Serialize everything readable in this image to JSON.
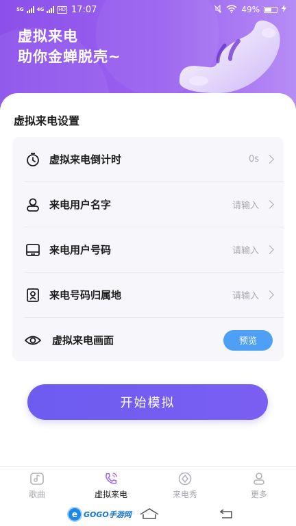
{
  "status_bar": {
    "net1": "5G",
    "net2": "4G",
    "hd": "HD",
    "time": "17:07",
    "battery": "49%"
  },
  "hero": {
    "line1": "虚拟来电",
    "line2": "助你金蝉脱壳~"
  },
  "settings": {
    "title": "虚拟来电设置",
    "rows": [
      {
        "label": "虚拟来电倒计时",
        "value": "0s",
        "icon": "timer-icon"
      },
      {
        "label": "来电用户名字",
        "value": "请输入",
        "icon": "user-icon"
      },
      {
        "label": "来电用户号码",
        "value": "请输入",
        "icon": "phone-number-icon"
      },
      {
        "label": "来电号码归属地",
        "value": "请输入",
        "icon": "location-icon"
      },
      {
        "label": "虚拟来电画面",
        "button": "预览",
        "icon": "eye-icon"
      }
    ]
  },
  "start_button": "开始模拟",
  "tabs": [
    {
      "label": "歌曲",
      "icon": "music-icon",
      "active": false
    },
    {
      "label": "虚拟来电",
      "icon": "call-icon",
      "active": true
    },
    {
      "label": "来电秀",
      "icon": "show-icon",
      "active": false
    },
    {
      "label": "更多",
      "icon": "more-icon",
      "active": false
    }
  ],
  "watermark": {
    "badge": "e",
    "text": "GOGO手游网"
  },
  "colors": {
    "hero_gradient_start": "#8c50ea",
    "hero_gradient_end": "#b68cf5",
    "primary_button": "#6d5cf0",
    "preview_button": "#4e9ff6",
    "settings_bg": "#f6f6fb",
    "active_tab_icon": "#9a62f0"
  }
}
